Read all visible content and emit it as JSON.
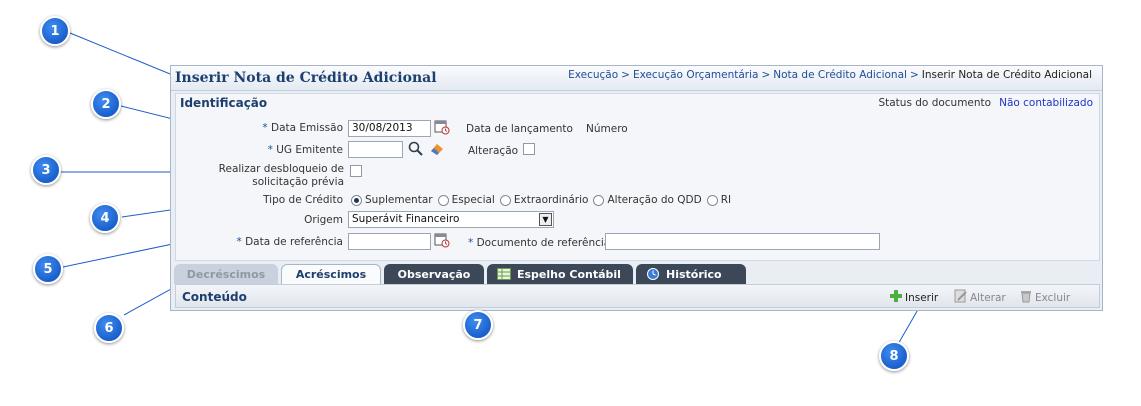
{
  "header": {
    "title": "Inserir Nota de Crédito Adicional",
    "breadcrumb": [
      "Execução",
      "Execução Orçamentária",
      "Nota de Crédito Adicional",
      "Inserir Nota de Crédito Adicional"
    ],
    "breadcrumb_sep": ">"
  },
  "identificacao": {
    "title": "Identificação",
    "status_label": "Status do documento",
    "status_value": "Não contabilizado",
    "data_emissao": {
      "required": "*",
      "label": "Data Emissão",
      "value": "30/08/2013"
    },
    "data_lancamento_label": "Data de lançamento",
    "numero_label": "Número",
    "ug_emitente": {
      "required": "*",
      "label": "UG Emitente",
      "value": ""
    },
    "alteracao_label": "Alteração",
    "desbloqueio_label_1": "Realizar desbloqueio de",
    "desbloqueio_label_2": "solicitação prévia",
    "tipo_credito_label": "Tipo de Crédito",
    "tipo_credito_options": [
      "Suplementar",
      "Especial",
      "Extraordinário",
      "Alteração do QDD",
      "RI"
    ],
    "tipo_credito_selected": "Suplementar",
    "origem_label": "Origem",
    "origem_value": "Superávit Financeiro",
    "data_referencia": {
      "required": "*",
      "label": "Data de referência",
      "value": ""
    },
    "documento_referencia": {
      "required": "*",
      "label": "Documento de referência",
      "value": ""
    }
  },
  "tabs": [
    "Decréscimos",
    "Acréscimos",
    "Observação",
    "Espelho Contábil",
    "Histórico"
  ],
  "content": {
    "title": "Conteúdo",
    "inserir_label": "Inserir",
    "alterar_label": "Alterar",
    "excluir_label": "Excluir"
  },
  "callouts": [
    "1",
    "2",
    "3",
    "4",
    "5",
    "6",
    "7",
    "8"
  ],
  "colors": {
    "callout": "#1a5fcc",
    "title": "#1d3f6e",
    "link": "#2035c8",
    "dark_tab": "#3c4858"
  }
}
